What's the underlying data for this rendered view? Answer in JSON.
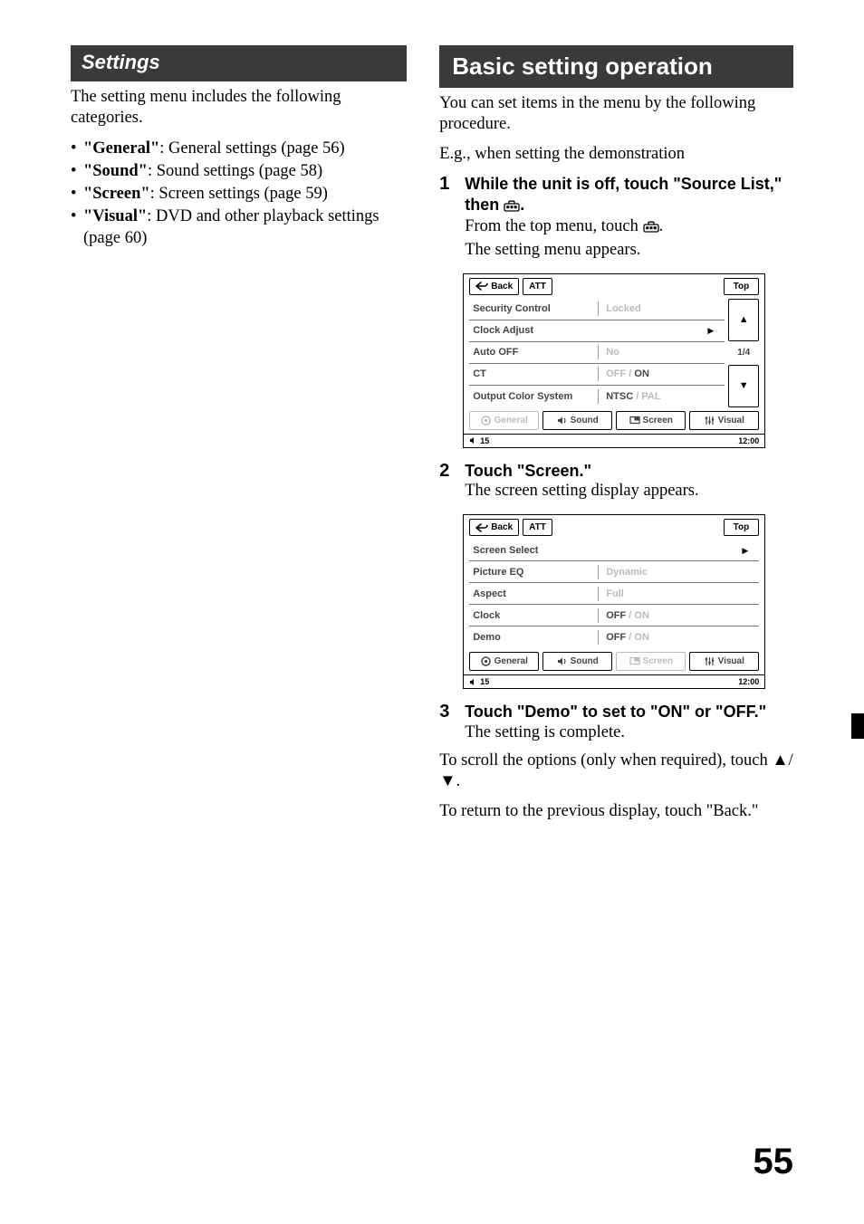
{
  "left": {
    "heading": "Settings",
    "intro": "The setting menu includes the following categories.",
    "bullets": [
      {
        "bold": "\"General\"",
        "rest": ": General settings (page 56)"
      },
      {
        "bold": "\"Sound\"",
        "rest": ": Sound settings (page 58)"
      },
      {
        "bold": "\"Screen\"",
        "rest": ": Screen settings (page 59)"
      },
      {
        "bold": "\"Visual\"",
        "rest": ": DVD and other playback settings (page 60)"
      }
    ]
  },
  "right": {
    "heading": "Basic setting operation",
    "intro1": "You can set items in the menu by the following procedure.",
    "intro2": "E.g., when setting the demonstration",
    "step1": {
      "num": "1",
      "head_a": "While the unit is off, touch \"Source List,\" then ",
      "head_b": ".",
      "line1_a": "From the top menu, touch ",
      "line1_b": ".",
      "line2": "The setting menu appears."
    },
    "step2": {
      "num": "2",
      "head": "Touch \"Screen.\"",
      "line1": "The screen setting display appears."
    },
    "step3": {
      "num": "3",
      "head": "Touch \"Demo\" to set to \"ON\" or \"OFF.\"",
      "line1": "The setting is complete."
    },
    "post1": "To scroll the options (only when required), touch ▲/▼.",
    "post2": "To return to the previous display, touch \"Back.\""
  },
  "ss_common": {
    "back": "Back",
    "att": "ATT",
    "top": "Top",
    "tabs": {
      "general": "General",
      "sound": "Sound",
      "screen": "Screen",
      "visual": "Visual"
    },
    "footer_vol": "15",
    "footer_time": "12:00"
  },
  "ss1": {
    "page": "1/4",
    "rows": [
      {
        "label": "Security Control",
        "value_dim": "Locked",
        "value_on": "",
        "arrow": false
      },
      {
        "label": "Clock Adjust",
        "value_dim": "",
        "value_on": "",
        "arrow": true
      },
      {
        "label": "Auto OFF",
        "value_dim": "No",
        "value_on": "",
        "arrow": false
      },
      {
        "label": "CT",
        "value_dim": "OFF / ",
        "value_on": "ON",
        "arrow": false
      },
      {
        "label": "Output Color System",
        "value_dim": " / PAL",
        "value_on": "NTSC",
        "ntsc_first": true,
        "arrow": false
      }
    ]
  },
  "ss2": {
    "rows": [
      {
        "label": "Screen Select",
        "value_dim": "",
        "value_on": "",
        "arrow": true
      },
      {
        "label": "Picture EQ",
        "value_dim": "Dynamic",
        "value_on": "",
        "arrow": false
      },
      {
        "label": "Aspect",
        "value_dim": "Full",
        "value_on": "",
        "arrow": false
      },
      {
        "label": "Clock",
        "value_dim": " / ON",
        "value_on": "OFF",
        "ntsc_first": true,
        "arrow": false
      },
      {
        "label": "Demo",
        "value_dim": " / ON",
        "value_on": "OFF",
        "ntsc_first": true,
        "arrow": false
      }
    ]
  },
  "page_number": "55"
}
